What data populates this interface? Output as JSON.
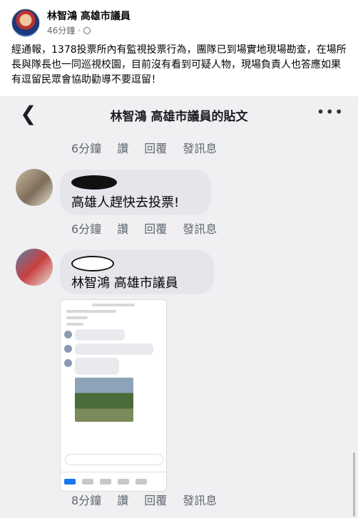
{
  "post": {
    "author": "林智鴻 高雄市議員",
    "time": "46分鐘 · ",
    "privacy_icon": "globe-icon",
    "text": "經通報，1378投票所內有監視投票行為，團隊已到場實地現場勘查，在場所長與隊長也一同巡視校園，目前沒有看到可疑人物，現場負責人也答應如果有逗留民眾會協助勸導不要逗留！"
  },
  "shot": {
    "nav_title": "林智鴻 高雄市議員的貼文",
    "back_glyph": "❮",
    "more_glyph": "•••",
    "comments": [
      {
        "actions": [
          "6分鐘",
          "讚",
          "回覆",
          "發訊息"
        ]
      },
      {
        "text": "高雄人趕快去投票!",
        "actions": [
          "6分鐘",
          "讚",
          "回覆",
          "發訊息"
        ]
      },
      {
        "text": "林智鴻 高雄市議員",
        "actions": [
          "8分鐘",
          "讚",
          "回覆",
          "發訊息"
        ]
      }
    ]
  }
}
